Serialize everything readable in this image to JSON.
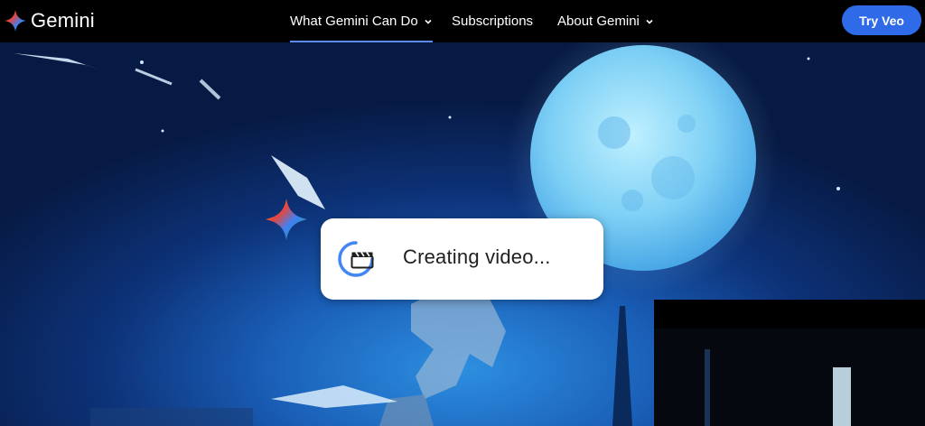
{
  "brand": {
    "name": "Gemini",
    "logo_icon": "gemini-sparkle-icon"
  },
  "nav": {
    "items": [
      {
        "label": "What Gemini Can Do",
        "has_dropdown": true,
        "active": true
      },
      {
        "label": "Subscriptions",
        "has_dropdown": false,
        "active": false
      },
      {
        "label": "About Gemini",
        "has_dropdown": true,
        "active": false
      }
    ],
    "cta_label": "Try Veo"
  },
  "status": {
    "text": "Creating video...",
    "icons": [
      "gemini-sparkle-icon",
      "loading-spinner-icon",
      "clapperboard-icon"
    ]
  },
  "colors": {
    "nav_bg": "#000000",
    "cta_bg": "#2f6ae8",
    "active_underline": "#5b8cff",
    "sky_dark": "#071a44",
    "sky_light": "#2d8fe0",
    "moon": "#7ed0f5"
  }
}
